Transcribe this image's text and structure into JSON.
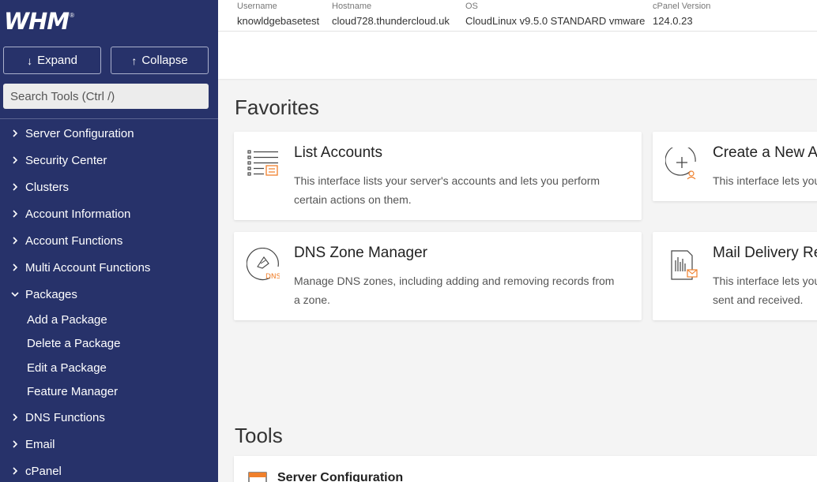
{
  "sidebar": {
    "logo": "WHM",
    "logo_mark": "®",
    "expand_label": "Expand",
    "collapse_label": "Collapse",
    "search_placeholder": "Search Tools (Ctrl /)",
    "nav": [
      {
        "label": "Server Configuration",
        "state": "collapsed"
      },
      {
        "label": "Security Center",
        "state": "collapsed"
      },
      {
        "label": "Clusters",
        "state": "collapsed"
      },
      {
        "label": "Account Information",
        "state": "collapsed"
      },
      {
        "label": "Account Functions",
        "state": "collapsed"
      },
      {
        "label": "Multi Account Functions",
        "state": "collapsed"
      },
      {
        "label": "Packages",
        "state": "expanded"
      },
      {
        "label": "DNS Functions",
        "state": "collapsed"
      },
      {
        "label": "Email",
        "state": "collapsed"
      },
      {
        "label": "cPanel",
        "state": "collapsed"
      }
    ],
    "packages_sub": [
      "Add a Package",
      "Delete a Package",
      "Edit a Package",
      "Feature Manager"
    ]
  },
  "info": {
    "username_label": "Username",
    "username": "knowldgebasetest",
    "hostname_label": "Hostname",
    "hostname": "cloud728.thundercloud.uk",
    "os_label": "OS",
    "os": "CloudLinux v9.5.0 STANDARD vmware",
    "cpanel_label": "cPanel Version",
    "cpanel": "124.0.23"
  },
  "favorites": {
    "title": "Favorites",
    "cards": [
      {
        "title": "List Accounts",
        "desc": "This interface lists your server's accounts and lets you perform certain actions on them.",
        "icon": "list-accounts-icon"
      },
      {
        "title": "Create a New Account",
        "desc": "This interface lets you create a new account.",
        "icon": "plus-circle-icon"
      },
      {
        "title": "DNS Zone Manager",
        "desc": "Manage DNS zones, including adding and removing records from a zone.",
        "icon": "dns-icon",
        "icon_text": "DNS"
      },
      {
        "title": "Mail Delivery Reports",
        "desc": "This interface lets you view reports for messages that the system sent and received.",
        "icon": "mail-report-icon"
      }
    ]
  },
  "tools": {
    "title": "Tools",
    "first_group": "Server Configuration"
  },
  "colors": {
    "sidebar_bg": "#27326a",
    "accent_orange": "#f0802c"
  }
}
